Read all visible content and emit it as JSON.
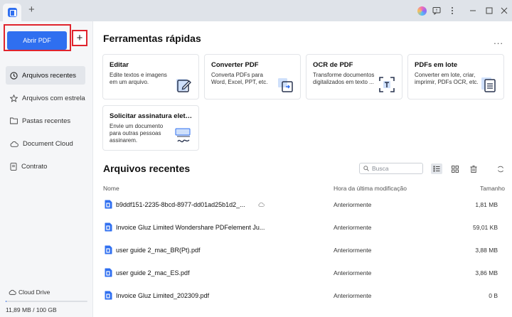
{
  "titlebar": {
    "new_tab": "+"
  },
  "sidebar": {
    "open_button": "Abrir PDF",
    "add_button": "+",
    "items": [
      {
        "label": "Arquivos recentes",
        "icon": "clock-icon",
        "active": true
      },
      {
        "label": "Arquivos com estrela",
        "icon": "star-icon",
        "active": false
      },
      {
        "label": "Pastas recentes",
        "icon": "folder-icon",
        "active": false
      },
      {
        "label": "Document Cloud",
        "icon": "cloud-icon",
        "active": false
      },
      {
        "label": "Contrato",
        "icon": "contract-icon",
        "active": false
      }
    ],
    "cloud_drive": "Cloud Drive",
    "storage_text": "11,89 MB / 100 GB",
    "storage_fraction": 0.0001
  },
  "quick_tools": {
    "title": "Ferramentas rápidas",
    "more": "...",
    "cards": [
      {
        "title": "Editar",
        "desc": "Edite textos e imagens em um arquivo.",
        "icon": "edit-icon"
      },
      {
        "title": "Converter PDF",
        "desc": "Converta PDFs para Word, Excel, PPT, etc.",
        "icon": "convert-icon"
      },
      {
        "title": "OCR de PDF",
        "desc": "Transforme documentos digitalizados em texto ...",
        "icon": "ocr-icon"
      },
      {
        "title": "PDFs em lote",
        "desc": "Converter em lote, criar, imprimir, PDFs OCR, etc.",
        "icon": "batch-icon"
      },
      {
        "title": "Solicitar assinatura eletrô...",
        "desc": "Envie um documento para outras pessoas assinarem.",
        "icon": "signature-icon"
      }
    ]
  },
  "recent": {
    "title": "Arquivos recentes",
    "search_placeholder": "Busca",
    "columns": {
      "name": "Nome",
      "modified": "Hora da última modificação",
      "size": "Tamanho"
    },
    "files": [
      {
        "name": "b9ddf151-2235-8bcd-8977-dd01ad25b1d2_...",
        "modified": "Anteriormente",
        "size": "1,81 MB",
        "cloud": true
      },
      {
        "name": "Invoice Gluz Limited Wondershare PDFelement Ju...",
        "modified": "Anteriormente",
        "size": "59,01 KB",
        "cloud": false
      },
      {
        "name": "user guide 2_mac_BR(Pt).pdf",
        "modified": "Anteriormente",
        "size": "3,88 MB",
        "cloud": false
      },
      {
        "name": "user guide 2_mac_ES.pdf",
        "modified": "Anteriormente",
        "size": "3,86 MB",
        "cloud": false
      },
      {
        "name": "Invoice Gluz Limited_202309.pdf",
        "modified": "Anteriormente",
        "size": "0 B",
        "cloud": false
      }
    ]
  },
  "colors": {
    "accent": "#2f6ff0",
    "highlight": "#e0242d"
  }
}
